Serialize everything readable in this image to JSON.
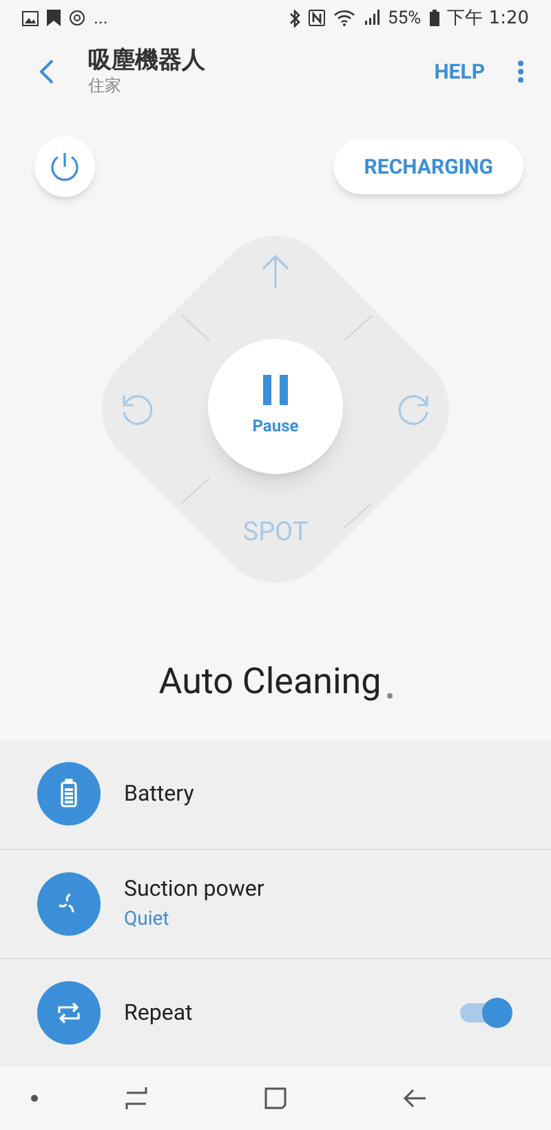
{
  "status_bar": {
    "notification_dots": "...",
    "battery": "55%",
    "time": "下午 1:20"
  },
  "header": {
    "title": "吸塵機器人",
    "subtitle": "住家",
    "help": "HELP"
  },
  "recharge_button": "RECHARGING",
  "pad": {
    "center_label": "Pause",
    "spot": "SPOT"
  },
  "status": "Auto Cleaning",
  "settings": [
    {
      "kind": "plain",
      "label": "Battery"
    },
    {
      "kind": "value",
      "label": "Suction power",
      "value": "Quiet"
    },
    {
      "kind": "toggle",
      "label": "Repeat",
      "on": true
    }
  ]
}
